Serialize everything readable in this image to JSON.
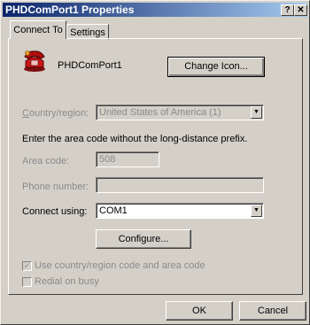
{
  "window": {
    "title": "PHDComPort1 Properties",
    "help_glyph": "?",
    "close_glyph": "✕"
  },
  "tabs": [
    {
      "label": "Connect To",
      "active": true
    },
    {
      "label": "Settings",
      "active": false
    }
  ],
  "connection": {
    "name": "PHDComPort1",
    "icon": "phone-icon",
    "change_icon_label": "Change Icon..."
  },
  "country": {
    "label": "Country/region:",
    "value": "United States of America (1)"
  },
  "hint": "Enter the area code without the long-distance prefix.",
  "area_code": {
    "label": "Area code:",
    "value": "508"
  },
  "phone_number": {
    "label": "Phone number:",
    "value": ""
  },
  "connect_using": {
    "label": "Connect using:",
    "value": "COM1"
  },
  "configure_label": "Configure...",
  "checkboxes": [
    {
      "label": "Use country/region code and area code",
      "checked": true,
      "enabled": false
    },
    {
      "label": "Redial on busy",
      "checked": false,
      "enabled": false
    }
  ],
  "buttons": {
    "ok": "OK",
    "cancel": "Cancel"
  },
  "colors": {
    "face": "#d4d0c8",
    "title_start": "#0a246a",
    "title_end": "#a6caf0",
    "disabled_text": "#8a8a8a"
  }
}
